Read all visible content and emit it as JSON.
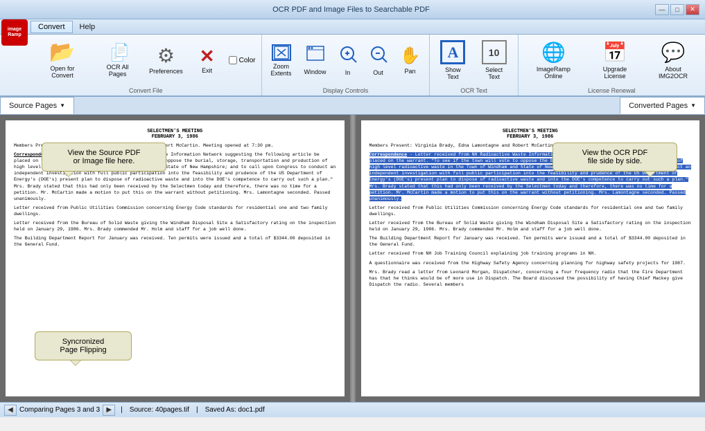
{
  "titlebar": {
    "title": "OCR PDF and Image Files to Searchable PDF",
    "minimize": "—",
    "maximize": "□",
    "close": "✕"
  },
  "menubar": {
    "items": [
      {
        "id": "convert",
        "label": "Convert"
      },
      {
        "id": "help",
        "label": "Help"
      }
    ]
  },
  "toolbar": {
    "groups": [
      {
        "id": "convert-file",
        "label": "Convert File",
        "items": [
          {
            "id": "open-for-convert",
            "icon": "📂",
            "label": "Open for Convert",
            "color": "yellow"
          },
          {
            "id": "ocr-all-pages",
            "icon": "📄",
            "label": "OCR All Pages",
            "color": "blue"
          },
          {
            "id": "preferences",
            "icon": "⚙",
            "label": "Preferences",
            "color": "gray"
          },
          {
            "id": "exit",
            "icon": "✕",
            "label": "Exit",
            "color": "red"
          }
        ],
        "extra": {
          "id": "color-check",
          "label": "Color"
        }
      },
      {
        "id": "display-controls",
        "label": "Display Controls",
        "items": [
          {
            "id": "zoom-extents",
            "icon": "⊡",
            "label": "Zoom\nExtents",
            "color": "blue"
          },
          {
            "id": "window",
            "icon": "⊞",
            "label": "Window",
            "color": "blue"
          },
          {
            "id": "zoom-in",
            "icon": "🔍",
            "label": "In",
            "color": "blue"
          },
          {
            "id": "zoom-out",
            "icon": "🔍",
            "label": "Out",
            "color": "blue"
          },
          {
            "id": "pan",
            "icon": "✋",
            "label": "Pan",
            "color": "orange"
          }
        ]
      },
      {
        "id": "ocr-text",
        "label": "OCR Text",
        "items": [
          {
            "id": "show-text",
            "icon": "A",
            "label": "Show Text",
            "color": "blue"
          },
          {
            "id": "select-text",
            "icon": "10",
            "label": "Select Text",
            "color": "gray"
          }
        ]
      },
      {
        "id": "license-renewal",
        "label": "License Renewal",
        "items": [
          {
            "id": "imageramp-online",
            "icon": "🌐",
            "label": "ImageRamp Online",
            "color": "blue"
          },
          {
            "id": "upgrade-license",
            "icon": "📅",
            "label": "Upgrade License",
            "color": "blue"
          },
          {
            "id": "about-img2ocr",
            "icon": "💬",
            "label": "About IMG2OCR",
            "color": "blue"
          }
        ]
      }
    ]
  },
  "tabs": {
    "left": {
      "label": "Source Pages",
      "arrow": "▼"
    },
    "right": {
      "label": "Converted Pages",
      "arrow": "▼"
    }
  },
  "callouts": {
    "left": {
      "title": "View the Source PDF",
      "subtitle": "or Image file here."
    },
    "right": {
      "title": "View the OCR PDF",
      "subtitle": "file side by side."
    },
    "bottom": {
      "title": "Syncronized",
      "subtitle": "Page Flipping"
    }
  },
  "document": {
    "title1": "SELECTMEN'S MEETING",
    "title2": "FEBRUARY 3, 1986",
    "members": "Members Present: Virginia Brady, Edna Lamontagne and Robert McCartin.  Meeting opened at 7:30 pm.",
    "correspondence_label": "Correspondence",
    "correspondence_text": "- Letter received from NH Radioactive Waste Information Network suggesting the following article be placed on the warrant.  \"To see if the town will vote to oppose the burial, storage, transportation and production of high level radioactive waste in the Town of Windham and State of New Hampshire; and to call upon Congress to conduct an independent investigation with full public participation into the feasibility and prudence of the US Department of Energy's (DOE's) present plan to dispose of radioactive waste and into the DOE's competence to carry out such a plan.\"  Mrs. Brady stated that this had only been received by the Selectmen today and therefore, there was no time for a petition.  Mr. McCartin made a motion to put this on the warrant without petitioning.  Mrs. Lamontagne seconded. Passed unanimously.",
    "para2": "Letter received from Public Utilities Commission concerning Energy Code standards for residential one and two family dwellings.",
    "para3": "Letter received from the Bureau of Solid Waste giving the Windham Disposal Site a Satisfactory rating on the inspection held on January 29, 1986.  Mrs. Brady commended Mr. Holm and staff for a job well done.",
    "para4": "The Building Department Report for January was received.  Ten permits were issued and a total of $3344.00 deposited in the General Fund.",
    "para5": "Letter received from NH Job Training Council explaining job training programs in NH.",
    "para6": "A questionnaire was received from the Highway Safety Agency concerning planning for highway safety projects for 1987.",
    "para7": "Mrs. Brady read a letter from Leonard Morgan, Dispatcher, concerning a four frequency radio that the Fire Department has that he thinks would be of more use in Dispatch.  The Board discussed the possibility of having Chief Mackey give Dispatch the radio.  Several members"
  },
  "statusbar": {
    "comparing": "Comparing Pages 3 and 3",
    "source": "Source: 40pages.tif",
    "saved_as": "Saved As: doc1.pdf"
  },
  "logo": {
    "line1": "image",
    "line2": "Ramp"
  }
}
